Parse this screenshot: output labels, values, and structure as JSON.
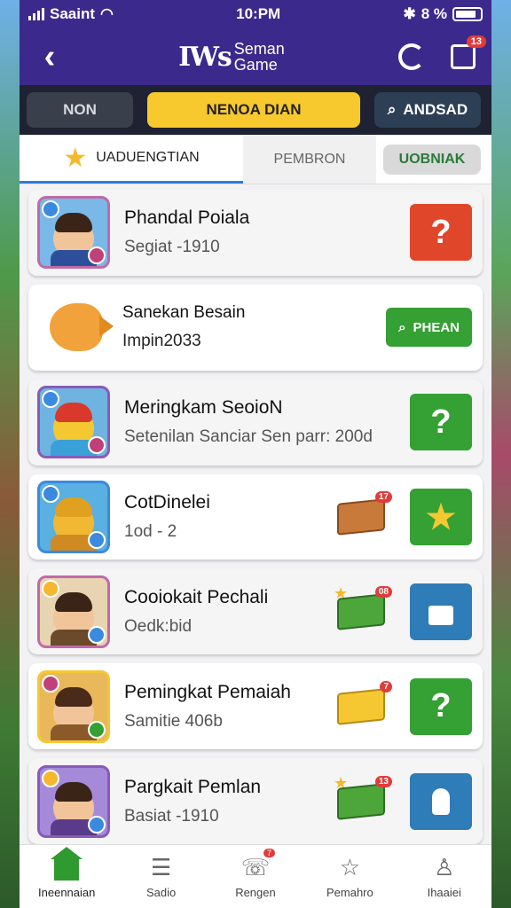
{
  "status": {
    "carrier": "Saaint",
    "time": "10:PM",
    "battery": "8 %"
  },
  "app_bar": {
    "title_logo": "IWs",
    "title_line1": "Seman",
    "title_line2": "Game",
    "cal_badge": "13"
  },
  "segments": [
    {
      "label": "NON"
    },
    {
      "label": "NENOA DIAN"
    },
    {
      "label": "ANDSAD"
    }
  ],
  "tabs": [
    {
      "label": "UADUENGTIAN"
    },
    {
      "label": "PEMBRON"
    },
    {
      "label": "UOBNIAK"
    }
  ],
  "items": [
    {
      "title": "Phandal Poiala",
      "subtitle": "Segiat -1910",
      "action": "?",
      "action_color": "#e0462a"
    },
    {
      "title": "Sanekan Besain",
      "subtitle": "Impin2033",
      "action": "PHEAN",
      "action_color": "#35a033"
    },
    {
      "title": "Meringkam SeoioN",
      "subtitle": "Setenilan Sanciar Sen parr: 200d",
      "action": "?",
      "action_color": "#35a033"
    },
    {
      "title": "CotDinelei",
      "subtitle": "1od - 2",
      "reward_badge": "17",
      "action": "★",
      "action_color": "#35a033"
    },
    {
      "title": "Cooiokait Pechali",
      "subtitle": "Oedk:bid",
      "reward_badge": "08",
      "action": "lock",
      "action_color": "#2e7cb8"
    },
    {
      "title": "Pemingkat Pemaiah",
      "subtitle": "Samitie 406b",
      "reward_badge": "7",
      "action": "?",
      "action_color": "#35a033"
    },
    {
      "title": "Pargkait Pemlan",
      "subtitle": "Basiat -1910",
      "reward_badge": "13",
      "action": "hand",
      "action_color": "#2e7cb8"
    }
  ],
  "bottom_nav": [
    {
      "label": "Ineennaian"
    },
    {
      "label": "Sadio"
    },
    {
      "label": "Rengen",
      "badge": "7"
    },
    {
      "label": "Pemahro"
    },
    {
      "label": "Ihaaiei"
    }
  ]
}
